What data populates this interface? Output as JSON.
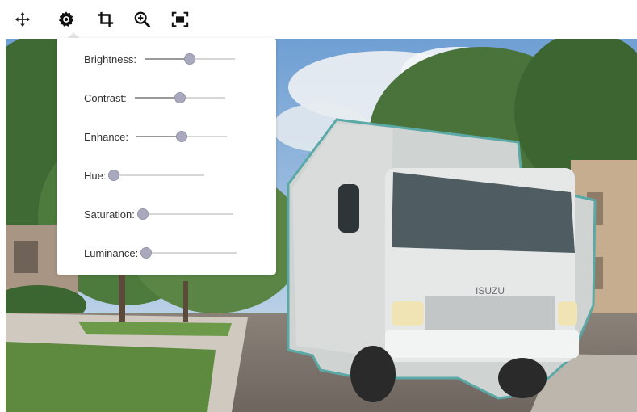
{
  "toolbar": {
    "tools": [
      {
        "id": "move",
        "icon": "move-icon"
      },
      {
        "id": "adjust",
        "icon": "settings-icon",
        "active": true
      },
      {
        "id": "crop",
        "icon": "crop-icon"
      },
      {
        "id": "zoom",
        "icon": "zoom-in-icon"
      },
      {
        "id": "fit",
        "icon": "fit-screen-icon"
      }
    ]
  },
  "panel": {
    "sliders": [
      {
        "label": "Brightness:",
        "value": 0.5
      },
      {
        "label": "Contrast:",
        "value": 0.5
      },
      {
        "label": "Enhance:",
        "value": 0.5
      },
      {
        "label": "Hue:",
        "value": 0.0
      },
      {
        "label": "Saturation:",
        "value": 0.0
      },
      {
        "label": "Luminance:",
        "value": 0.0
      }
    ]
  },
  "image": {
    "subject": "box truck",
    "grille_text": "ISUZU",
    "outline_color": "#5aa9a6"
  }
}
